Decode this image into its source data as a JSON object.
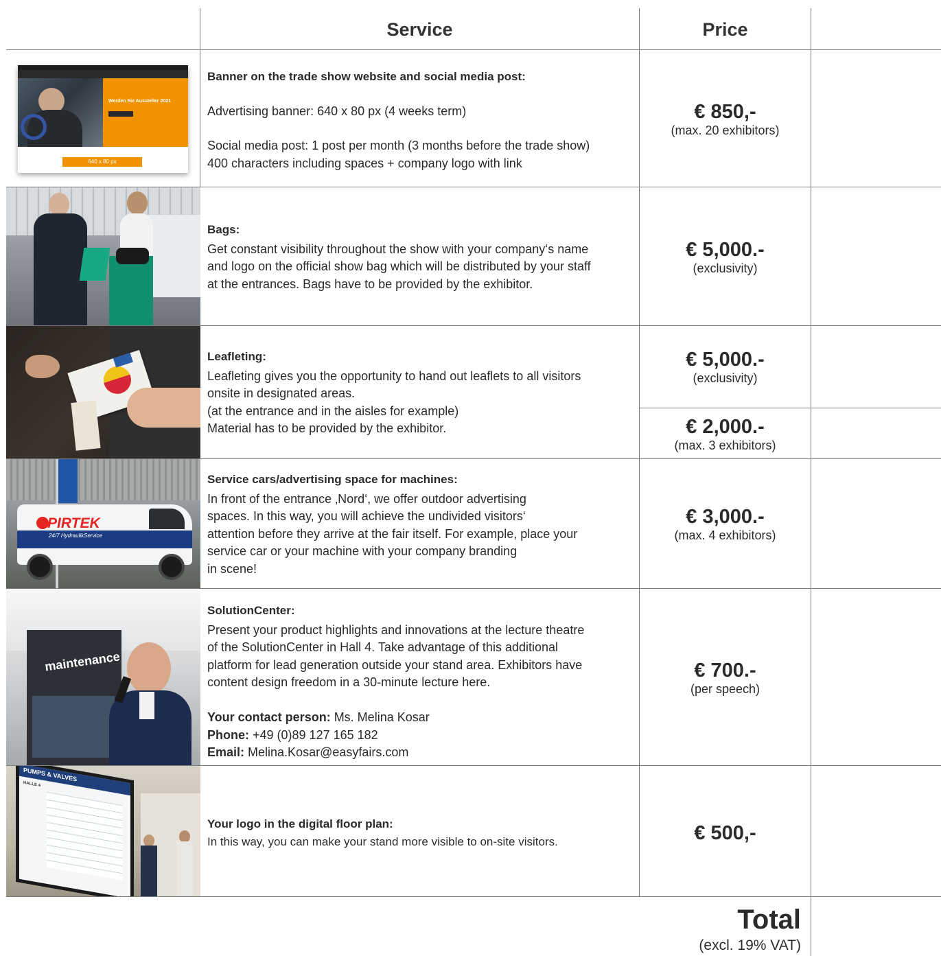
{
  "header": {
    "service": "Service",
    "price": "Price"
  },
  "rows": [
    {
      "title": "Banner on the trade show website and social media post:",
      "lines": [
        "Advertising banner: 640 x 80 px (4 weeks term)",
        "Social media post: 1 post per month (3 months before the trade show)",
        "400 characters including spaces + company logo with link"
      ],
      "price": "€ 850,-",
      "note": "(max. 20 exhibitors)",
      "mock": {
        "headline": "Werden Sie Aussteller 2021",
        "banner": "640 x 80 px"
      }
    },
    {
      "title": "Bags:",
      "lines": [
        "Get constant visibility throughout the show with your company‘s name",
        "and logo on the official show bag which will be distributed by your staff",
        "at the entrances. Bags have to be provided by the exhibitor."
      ],
      "price": "€ 5,000.-",
      "note": "(exclusivity)"
    },
    {
      "title": "Leafleting:",
      "lines": [
        "Leafleting gives you the opportunity to hand out leaflets to all visitors",
        "onsite in designated areas.",
        "(at the entrance and in the aisles for example)",
        "Material has to be provided by the exhibitor."
      ],
      "price": "€ 5,000.-",
      "note": "(exclusivity)",
      "price2": "€ 2,000.-",
      "note2": "(max. 3 exhibitors)"
    },
    {
      "title": "Service cars/advertising space for machines:",
      "lines": [
        "In front of the entrance ‚Nord‘, we offer outdoor advertising",
        "spaces. In this way, you will achieve the undivided visitors‘",
        "attention before they arrive at the fair itself. For example, place your",
        "service car or your machine with your company branding",
        "in scene!"
      ],
      "price": "€ 3,000.-",
      "note": "(max. 4 exhibitors)",
      "mock": {
        "brand": "PIRTEK",
        "tagline": "24/7 HydraulikService"
      }
    },
    {
      "title": "SolutionCenter:",
      "lines": [
        "Present your product highlights and innovations at the lecture theatre",
        "of the SolutionCenter in Hall 4. Take advantage of this additional",
        "platform for lead generation outside your stand area. Exhibitors have",
        "content design freedom in a 30-minute lecture here."
      ],
      "contact": {
        "person_label": "Your contact person:",
        "person": " Ms. Melina Kosar",
        "phone_label": "Phone:",
        "phone": " +49 (0)89 127 165 182",
        "email_label": "Email:",
        "email": " Melina.Kosar@easyfairs.com"
      },
      "price": "€ 700.-",
      "note": "(per speech)",
      "mock": {
        "wall": "maintenance"
      }
    },
    {
      "title": "Your logo in the digital floor plan:",
      "lines": [
        "In this way, you can make your stand more visible to on-site visitors."
      ],
      "price": "€ 500,-",
      "mock": {
        "screen_title": "PUMPS & VALVES",
        "hall": "HALLE 4"
      }
    }
  ],
  "total": {
    "label": "Total",
    "note": "(excl. 19% VAT)"
  },
  "colors": {
    "grid": "#7a7a7a",
    "accent_orange": "#f39200",
    "text": "#2b2b2b"
  }
}
